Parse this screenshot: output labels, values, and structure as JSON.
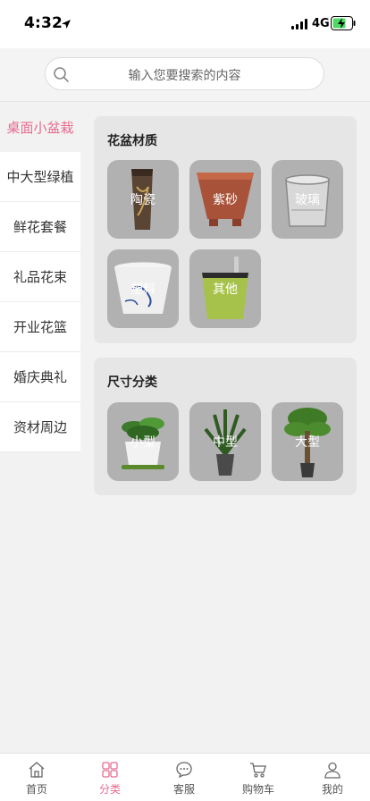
{
  "status_bar": {
    "time": "4:32",
    "network": "4G"
  },
  "search": {
    "placeholder": "输入您要搜索的内容"
  },
  "sidebar": {
    "items": [
      {
        "label": "桌面小盆栽",
        "active": true
      },
      {
        "label": "中大型绿植"
      },
      {
        "label": "鲜花套餐"
      },
      {
        "label": "礼品花束"
      },
      {
        "label": "开业花篮"
      },
      {
        "label": "婚庆典礼"
      },
      {
        "label": "资材周边"
      }
    ]
  },
  "sections": {
    "material": {
      "title": "花盆材质",
      "items": [
        {
          "label": "陶瓷",
          "icon": "ceramic-pot"
        },
        {
          "label": "紫砂",
          "icon": "clay-pot"
        },
        {
          "label": "玻璃",
          "icon": "glass-pot"
        },
        {
          "label": "塑料",
          "icon": "plastic-pot"
        },
        {
          "label": "其他",
          "icon": "other-pot"
        }
      ]
    },
    "size": {
      "title": "尺寸分类",
      "items": [
        {
          "label": "小型",
          "icon": "small-plant"
        },
        {
          "label": "中型",
          "icon": "medium-plant"
        },
        {
          "label": "大型",
          "icon": "large-plant"
        }
      ]
    }
  },
  "tab_bar": {
    "tabs": [
      {
        "label": "首页",
        "icon": "home-icon"
      },
      {
        "label": "分类",
        "icon": "category-icon",
        "active": true
      },
      {
        "label": "客服",
        "icon": "chat-icon"
      },
      {
        "label": "购物车",
        "icon": "cart-icon"
      },
      {
        "label": "我的",
        "icon": "user-icon"
      }
    ]
  },
  "colors": {
    "accent": "#e76b8f",
    "tile": "#b1b1b1",
    "card": "#e6e6e6"
  }
}
